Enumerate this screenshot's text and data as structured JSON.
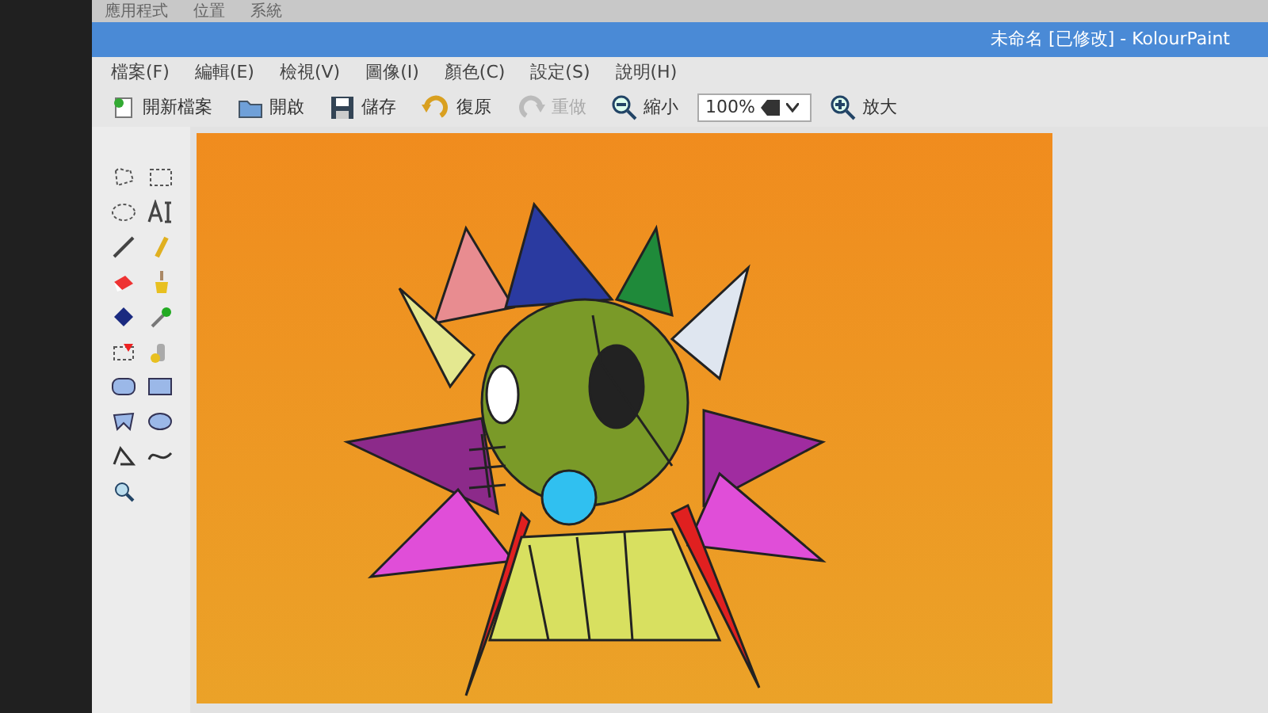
{
  "taskbar": {
    "menus": [
      "應用程式",
      "位置",
      "系統"
    ]
  },
  "window": {
    "title": "未命名 [已修改] - KolourPaint"
  },
  "menu": [
    "檔案(F)",
    "編輯(E)",
    "檢視(V)",
    "圖像(I)",
    "顏色(C)",
    "設定(S)",
    "說明(H)"
  ],
  "toolbar": [
    {
      "kind": "new",
      "label": "開新檔案",
      "disabled": false
    },
    {
      "kind": "open",
      "label": "開啟",
      "disabled": false
    },
    {
      "kind": "save",
      "label": "儲存",
      "disabled": false
    },
    {
      "kind": "undo",
      "label": "復原",
      "disabled": false
    },
    {
      "kind": "redo",
      "label": "重做",
      "disabled": true
    },
    {
      "kind": "zoomout",
      "label": "縮小",
      "disabled": false
    },
    {
      "kind": "zoomfield",
      "value": "100%"
    },
    {
      "kind": "zoomin",
      "label": "放大",
      "disabled": false
    }
  ]
}
